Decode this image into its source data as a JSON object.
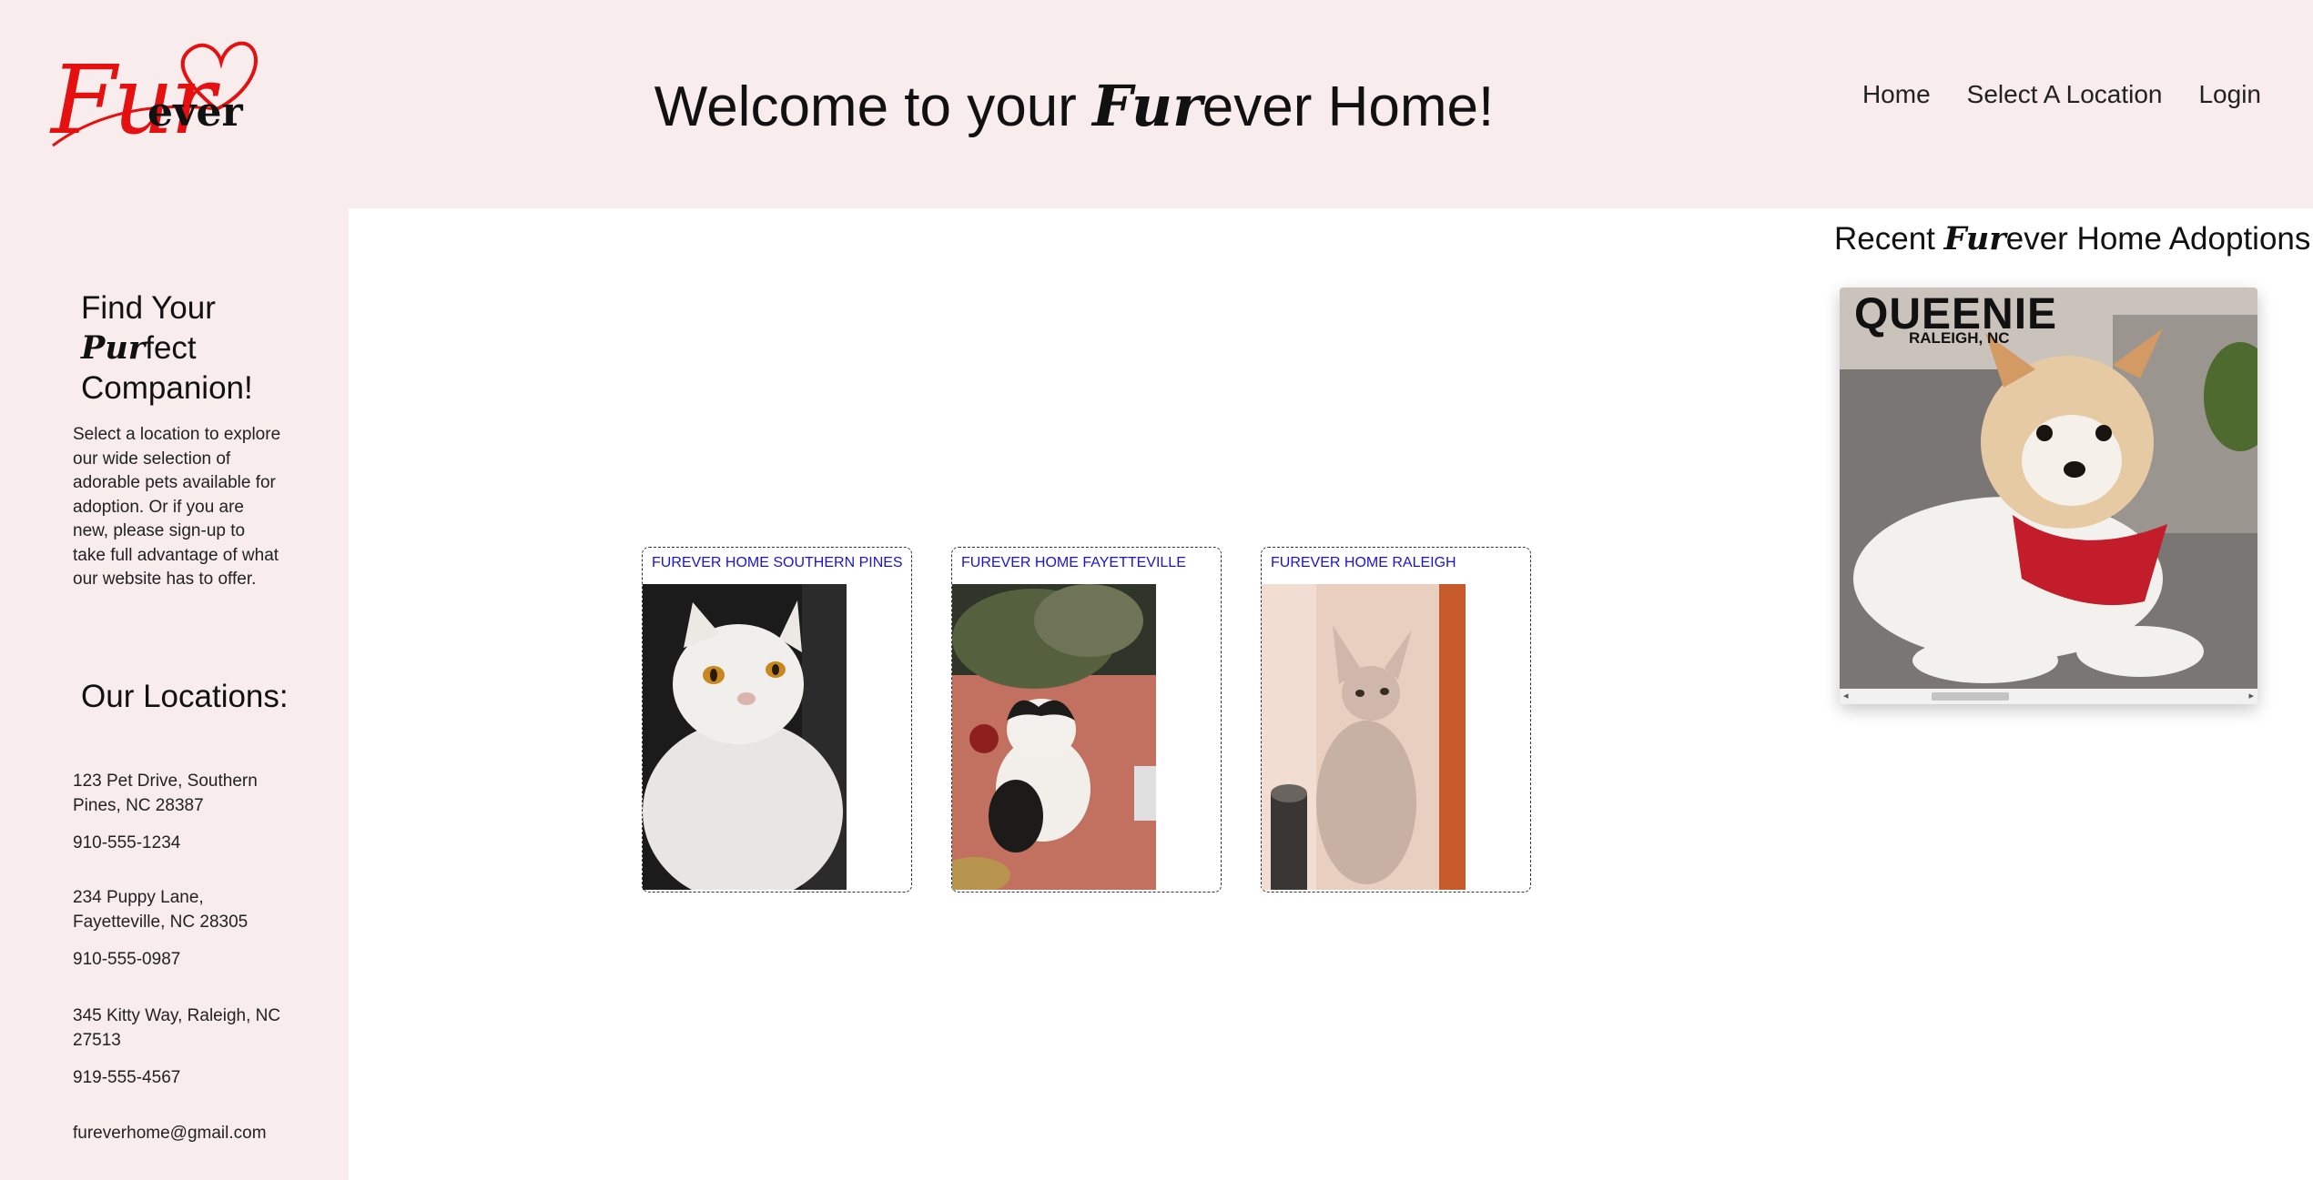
{
  "header": {
    "logo": {
      "fur": "Fur",
      "ever": "ever"
    },
    "welcome": {
      "before": "Welcome to your ",
      "fur": "Fur",
      "after": "ever Home!"
    },
    "nav": [
      "Home",
      "Select A Location",
      "Login"
    ]
  },
  "sidebar": {
    "find": {
      "line1": "Find Your",
      "pur": "Pur",
      "fect": "fect",
      "line3": "Companion!"
    },
    "intro": "Select a location to explore our wide selection of adorable pets available for adoption. Or if you are new, please sign-up to take full advantage of what our website has to offer.",
    "locations_heading": "Our Locations:",
    "locations": [
      {
        "address": "123 Pet Drive, Southern Pines, NC 28387",
        "phone": "910-555-1234"
      },
      {
        "address": "234 Puppy Lane, Fayetteville, NC 28305",
        "phone": "910-555-0987"
      },
      {
        "address": "345 Kitty Way, Raleigh, NC 27513",
        "phone": "919-555-4567"
      }
    ],
    "email": "fureverhome@gmail.com"
  },
  "locations_cards": [
    {
      "label": "FUREVER HOME SOUTHERN PINES",
      "photo": "white-persian-cat-photo"
    },
    {
      "label": "FUREVER HOME FAYETTEVILLE",
      "photo": "black-white-cat-on-table-photo"
    },
    {
      "label": "FUREVER HOME RALEIGH",
      "photo": "sphynx-cat-by-window-photo"
    }
  ],
  "recent": {
    "title_before": "Recent ",
    "title_fur": "Fur",
    "title_after": "ever Home Adoptions!",
    "pet": {
      "name": "QUEENIE",
      "location": "RALEIGH, NC",
      "photo": "yorkie-dog-red-bandana-photo"
    }
  },
  "colors": {
    "background_pink": "#f8eced",
    "logo_red": "#e51010",
    "card_label_blue": "#1a13d6"
  },
  "icons": {
    "logo_heart": "heart-outline-icon",
    "scroll_left": "arrow-left-icon",
    "scroll_right": "arrow-right-icon"
  }
}
